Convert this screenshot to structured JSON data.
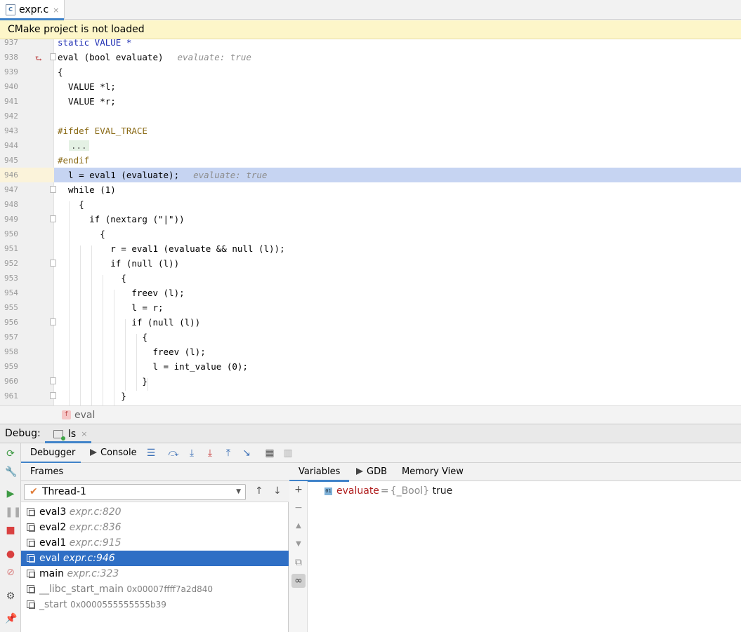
{
  "editor_tab": {
    "filename": "expr.c",
    "icon": "c-file-icon",
    "close": "×"
  },
  "banner": {
    "text": "CMake project is not loaded"
  },
  "code_lines": [
    {
      "n": "937",
      "text": "static VALUE *"
    },
    {
      "n": "938",
      "text": "eval (bool evaluate)",
      "hint": "evaluate: true"
    },
    {
      "n": "939",
      "text": "{"
    },
    {
      "n": "940",
      "text": "  VALUE *l;"
    },
    {
      "n": "941",
      "text": "  VALUE *r;"
    },
    {
      "n": "942",
      "text": ""
    },
    {
      "n": "943",
      "text": "#ifdef EVAL_TRACE"
    },
    {
      "n": "944",
      "text": "  ..."
    },
    {
      "n": "945",
      "text": "#endif"
    },
    {
      "n": "946",
      "text": "  l = eval1 (evaluate);",
      "hint": "evaluate: true"
    },
    {
      "n": "947",
      "text": "  while (1)"
    },
    {
      "n": "948",
      "text": "    {"
    },
    {
      "n": "949",
      "text": "      if (nextarg (\"|\"))"
    },
    {
      "n": "950",
      "text": "        {"
    },
    {
      "n": "951",
      "text": "          r = eval1 (evaluate && null (l));"
    },
    {
      "n": "952",
      "text": "          if (null (l))"
    },
    {
      "n": "953",
      "text": "            {"
    },
    {
      "n": "954",
      "text": "              freev (l);"
    },
    {
      "n": "955",
      "text": "              l = r;"
    },
    {
      "n": "956",
      "text": "              if (null (l))"
    },
    {
      "n": "957",
      "text": "                {"
    },
    {
      "n": "958",
      "text": "                  freev (l);"
    },
    {
      "n": "959",
      "text": "                  l = int_value (0);"
    },
    {
      "n": "960",
      "text": "                }"
    },
    {
      "n": "961",
      "text": "            }"
    }
  ],
  "breadcrumb": {
    "badge": "f",
    "label": "eval"
  },
  "debug": {
    "title": "Debug:",
    "session": "ls",
    "session_close": "×",
    "tabs": {
      "debugger": "Debugger",
      "console": "Console"
    },
    "frames_header": "Frames",
    "thread": "Thread-1",
    "frames": [
      {
        "name": "eval3",
        "loc": "expr.c:820"
      },
      {
        "name": "eval2",
        "loc": "expr.c:836"
      },
      {
        "name": "eval1",
        "loc": "expr.c:915"
      },
      {
        "name": "eval",
        "loc": "expr.c:946"
      },
      {
        "name": "main",
        "loc": "expr.c:323"
      },
      {
        "name": "__libc_start_main",
        "addr": "0x00007ffff7a2d840"
      },
      {
        "name": "_start",
        "addr": "0x0000555555555b39"
      }
    ],
    "vars_tabs": {
      "variables": "Variables",
      "gdb": "GDB",
      "memory": "Memory View"
    },
    "variable": {
      "badge": "01",
      "name": "evaluate",
      "eq": "=",
      "type": "{_Bool}",
      "value": "true"
    }
  },
  "colors": {
    "accent": "#4083c9",
    "selection": "#2f6fc5",
    "current_line": "#c6d4f2",
    "banner": "#fdf6c9"
  }
}
